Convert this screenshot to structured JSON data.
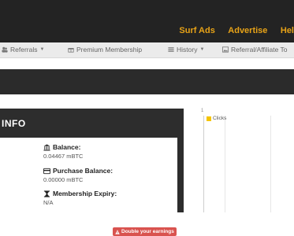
{
  "topnav": {
    "surf_ads": "Surf Ads",
    "advertise": "Advertise",
    "help": "Hel"
  },
  "subnav": {
    "referrals": "Referrals",
    "premium": "Premium Membership",
    "history": "History",
    "affiliate": "Referral/Affiliate To"
  },
  "panel": {
    "title": "INFO",
    "badge": "Double your earnings",
    "balance_label": "Balance:",
    "balance_value": "0.04467 mBTC",
    "purchase_label": "Purchase Balance:",
    "purchase_value": "0.00000 mBTC",
    "expiry_label": "Membership Expiry:",
    "expiry_value": "N/A"
  },
  "chart_data": {
    "type": "line",
    "series": [
      {
        "name": "Clicks",
        "values": []
      }
    ],
    "y_ticks": [
      "1"
    ],
    "legend_position": "top-left",
    "colors": {
      "Clicks": "#f5c400"
    }
  },
  "colors": {
    "accent": "#e8a317",
    "topbar": "#232323",
    "badge": "#d9534f"
  }
}
